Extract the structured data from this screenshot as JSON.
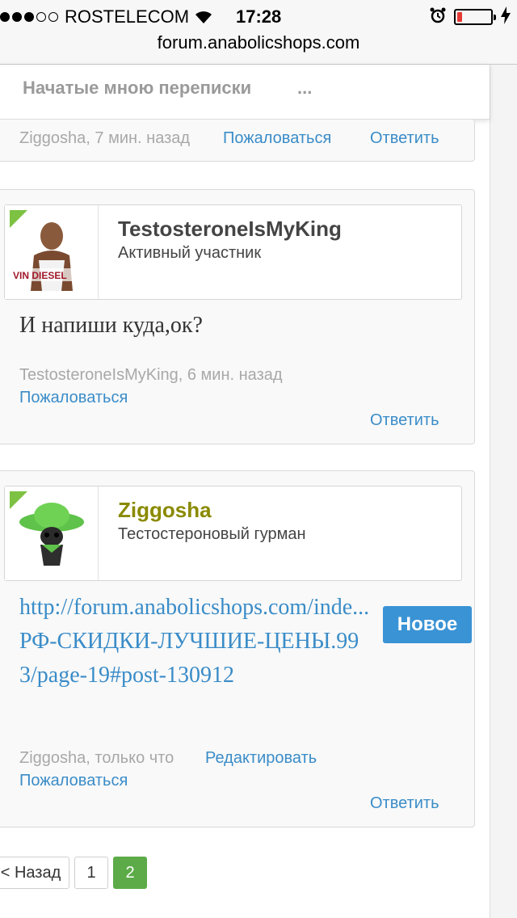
{
  "status_bar": {
    "carrier": "ROSTELECOM",
    "time": "17:28",
    "battery_color": "#e53935",
    "battery_level": 0.15
  },
  "url": "forum.anabolicshops.com",
  "nav": {
    "item1": "Начатые мною переписки",
    "more": "..."
  },
  "prev_post": {
    "meta": "Ziggosha, 7 мин. назад",
    "report": "Пожаловаться",
    "reply": "Ответить"
  },
  "post1": {
    "username": "TestosteroneIsMyKing",
    "user_title": "Активный участник",
    "message": "И напиши куда,ок?",
    "meta": "TestosteroneIsMyKing, 6 мин. назад",
    "report": "Пожаловаться",
    "reply": "Ответить",
    "avatar_text": "VIN DIESEL"
  },
  "post2": {
    "username": "Ziggosha",
    "username_color": "#8a8a00",
    "user_title": "Тестостероновый гурман",
    "link_text": "http://forum.anabolicshops.com/inde...РФ-СКИДКИ-ЛУЧШИЕ-ЦЕНЫ.993/page-19#post-130912",
    "badge": "Новое",
    "meta": "Ziggosha, только что",
    "edit": "Редактировать",
    "report": "Пожаловаться",
    "reply": "Ответить"
  },
  "pagination": {
    "back": "< Назад",
    "page1": "1",
    "page2": "2"
  },
  "colors": {
    "link": "#3a8cc8",
    "badge_blue": "#3a93d5",
    "page_active": "#5cab48",
    "online_corner": "#7dc242"
  }
}
